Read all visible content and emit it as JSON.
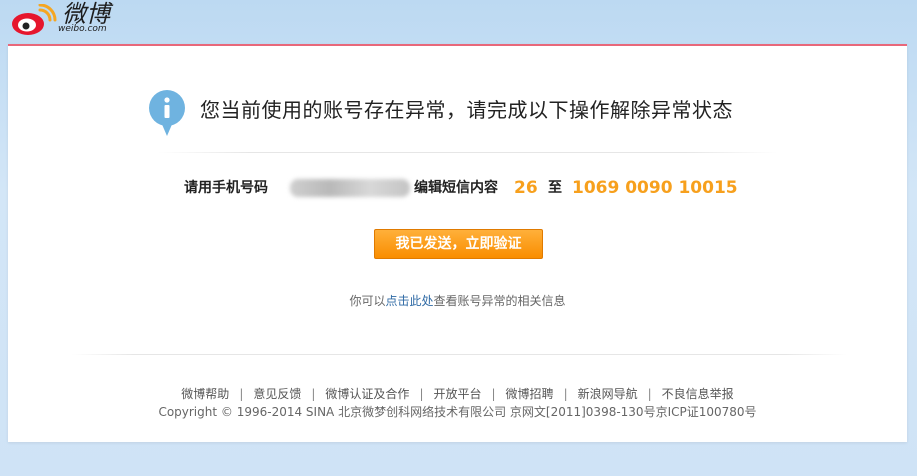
{
  "logo": {
    "wordmark": "微博",
    "domain": "weibo.com"
  },
  "alert": {
    "title": "您当前使用的账号存在异常，请完成以下操作解除异常状态"
  },
  "sms": {
    "phone_label": "请用手机号码",
    "edit_label": "编辑短信内容",
    "code": "26",
    "to_label": "至",
    "number": "1069 0090 10015"
  },
  "verify_button": "我已发送，立即验证",
  "hint": {
    "prefix": "你可以",
    "link": "点击此处",
    "suffix": "查看账号异常的相关信息"
  },
  "footer": {
    "links": [
      "微博帮助",
      "意见反馈",
      "微博认证及合作",
      "开放平台",
      "微博招聘",
      "新浪网导航",
      "不良信息举报"
    ],
    "separator": "|",
    "copyright": "Copyright © 1996-2014 SINA 北京微梦创科网络技术有限公司   京网文[2011]0398-130号京ICP证100780号"
  },
  "colors": {
    "accent": "#f7a01d",
    "link": "#2f6aa5",
    "card_border": "#e8677a"
  }
}
